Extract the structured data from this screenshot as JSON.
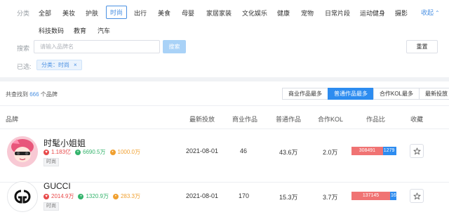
{
  "filters": {
    "category_label": "分类",
    "categories": [
      {
        "label": "全部"
      },
      {
        "label": "美妆"
      },
      {
        "label": "护肤"
      },
      {
        "label": "时尚"
      },
      {
        "label": "出行"
      },
      {
        "label": "美食"
      },
      {
        "label": "母婴"
      },
      {
        "label": "家居家装"
      },
      {
        "label": "文化娱乐"
      },
      {
        "label": "健康"
      },
      {
        "label": "宠物"
      },
      {
        "label": "日常片段"
      },
      {
        "label": "运动健身"
      },
      {
        "label": "摄影"
      },
      {
        "label": "科技数码"
      },
      {
        "label": "教育"
      },
      {
        "label": "汽车"
      }
    ],
    "active_category": "时尚",
    "collapse_label": "收起",
    "search_label": "搜索",
    "search_placeholder": "请输入品牌名",
    "search_button": "搜索",
    "reset_button": "重置",
    "selected_label": "已选:",
    "selected_tag": "分类：时尚"
  },
  "results": {
    "count_prefix": "共查找到",
    "count": "666",
    "count_suffix": "个品牌",
    "sort_tabs": [
      {
        "label": "商业作品最多",
        "active": false
      },
      {
        "label": "普通作品最多",
        "active": true
      },
      {
        "label": "合作KOL最多",
        "active": false
      },
      {
        "label": "最新投放",
        "active": false
      }
    ]
  },
  "table": {
    "headers": {
      "brand": "品牌",
      "latest": "最新投放",
      "commercial": "商业作品",
      "normal": "普通作品",
      "kol": "合作KOL",
      "ratio": "作品比",
      "favorite": "收藏"
    },
    "rows": [
      {
        "name": "时髦小姐姐",
        "avatar_icon": "cartoon-girl-avatar",
        "stat_red": "1.183亿",
        "stat_green": "6690.5万",
        "stat_orange": "1000.0万",
        "tag": "时尚",
        "latest": "2021-08-01",
        "commercial": "46",
        "normal": "43.6万",
        "kol": "2.0万",
        "ratio_red_value": "308491",
        "ratio_blue_value": "1279",
        "ratio_red_fraction": 0.7
      },
      {
        "name": "GUCCI",
        "avatar_icon": "gucci-logo-avatar",
        "stat_red": "2014.9万",
        "stat_green": "1320.9万",
        "stat_orange": "283.3万",
        "tag": "时尚",
        "latest": "2021-08-01",
        "commercial": "170",
        "normal": "15.3万",
        "kol": "3.7万",
        "ratio_red_value": "137145",
        "ratio_blue_value": "16",
        "ratio_red_fraction": 0.86
      }
    ]
  },
  "colors": {
    "accent": "#2d8cf0",
    "ratio_red": "#f07373",
    "stat_red": "#e84a4a",
    "stat_green": "#33b36b",
    "stat_orange": "#f0a030"
  }
}
